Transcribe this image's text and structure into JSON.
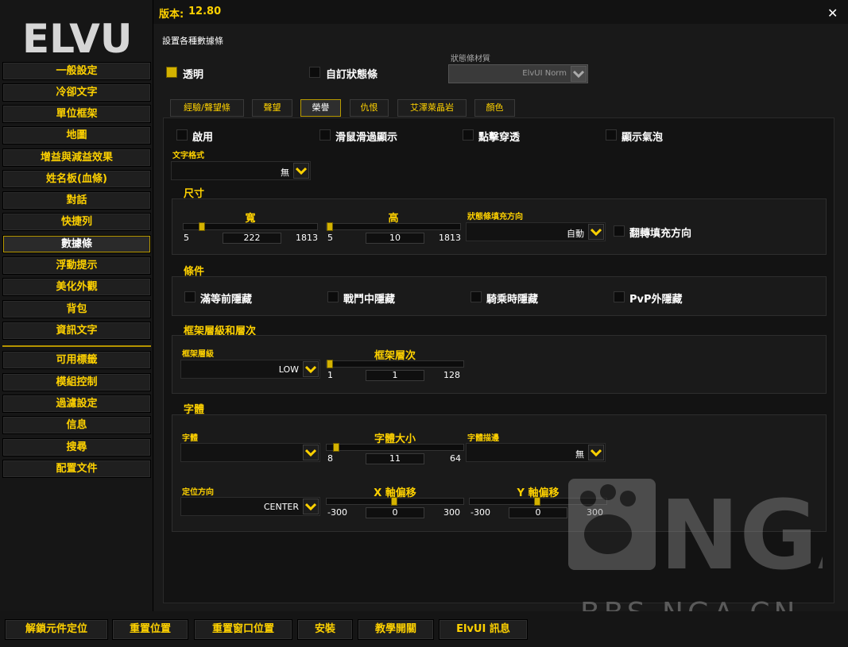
{
  "app": {
    "logo_text": "ELVUI",
    "version_label": "版本:",
    "version": "12.80",
    "close_symbol": "✕"
  },
  "sidebar": {
    "items": [
      {
        "label": "一般設定"
      },
      {
        "label": "冷卻文字"
      },
      {
        "label": "單位框架"
      },
      {
        "label": "地圖"
      },
      {
        "label": "增益與減益效果"
      },
      {
        "label": "姓名板(血條)"
      },
      {
        "label": "對話"
      },
      {
        "label": "快捷列"
      },
      {
        "label": "數據條",
        "active": true
      },
      {
        "label": "浮動提示"
      },
      {
        "label": "美化外觀"
      },
      {
        "label": "背包"
      },
      {
        "label": "資訊文字"
      },
      {
        "label": "可用標籤"
      },
      {
        "label": "模組控制"
      },
      {
        "label": "過濾設定"
      },
      {
        "label": "信息"
      },
      {
        "label": "搜尋"
      },
      {
        "label": "配置文件"
      }
    ]
  },
  "page": {
    "heading": "設置各種數據條",
    "transparent_label": "透明",
    "transparent_checked": true,
    "custom_bar_label": "自訂狀態條",
    "custom_bar_checked": false,
    "texture_label": "狀態條材質",
    "texture_value": "ElvUI Norm"
  },
  "tabs": [
    {
      "label": "經驗/聲望條"
    },
    {
      "label": "聲望"
    },
    {
      "label": "榮譽",
      "active": true
    },
    {
      "label": "仇恨"
    },
    {
      "label": "艾澤萊晶岩"
    },
    {
      "label": "顏色"
    }
  ],
  "honor": {
    "enable_label": "啟用",
    "mouseover_label": "滑鼠滑過顯示",
    "clickthrough_label": "點擊穿透",
    "tooltip_label": "顯示氣泡",
    "text_format_label": "文字格式",
    "text_format_value": "無",
    "size": {
      "title": "尺寸",
      "width": {
        "title": "寬",
        "min": "5",
        "max": "1813",
        "value": "222",
        "fraction": 0.12
      },
      "height": {
        "title": "高",
        "min": "5",
        "max": "1813",
        "value": "10",
        "fraction": 0.003
      },
      "orientation_label": "狀態條填充方向",
      "orientation_value": "自動",
      "reverse_label": "翻轉填充方向"
    },
    "conditions": {
      "title": "條件",
      "items": [
        {
          "label": "滿等前隱藏"
        },
        {
          "label": "戰鬥中隱藏"
        },
        {
          "label": "騎乘時隱藏"
        },
        {
          "label": "PvP外隱藏"
        }
      ]
    },
    "strata": {
      "title": "框架層級和層次",
      "strata_label": "框架層級",
      "strata_value": "LOW",
      "level": {
        "title": "框架層次",
        "min": "1",
        "max": "128",
        "value": "1",
        "fraction": 0.0
      }
    },
    "font": {
      "title": "字體",
      "font_label": "字體",
      "font_value": "",
      "size": {
        "title": "字體大小",
        "min": "8",
        "max": "64",
        "value": "11",
        "fraction": 0.05
      },
      "outline_label": "字體描邊",
      "outline_value": "無",
      "anchor_label": "定位方向",
      "anchor_value": "CENTER",
      "x_offset": {
        "title": "X 軸偏移",
        "min": "-300",
        "max": "300",
        "value": "0",
        "fraction": 0.5
      },
      "y_offset": {
        "title": "Y 軸偏移",
        "min": "-300",
        "max": "300",
        "value": "0",
        "fraction": 0.5
      }
    }
  },
  "bottom_buttons": [
    {
      "label": "解鎖元件定位"
    },
    {
      "label": "重置位置"
    },
    {
      "label": "重置窗口位置"
    },
    {
      "label": "安裝"
    },
    {
      "label": "教學開關"
    },
    {
      "label": "ElvUI 訊息"
    }
  ],
  "watermark": {
    "text": "BBS.NGA.CN",
    "logo_text": "NGA"
  },
  "colors": {
    "accent": "#fed100",
    "checked": "#d4b200",
    "panel": "#191919"
  }
}
